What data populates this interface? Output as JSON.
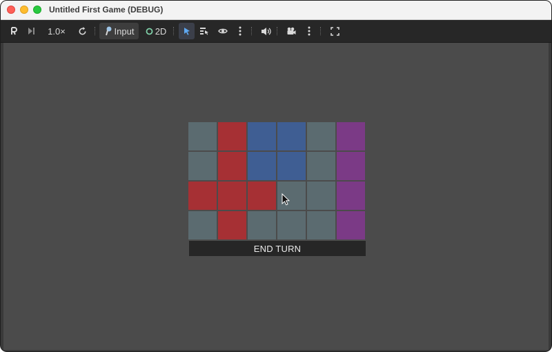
{
  "window": {
    "title": "Untitled First Game (DEBUG)"
  },
  "toolbar": {
    "speed_label": "1.0×",
    "input_label": "Input",
    "mode_2d_label": "2D"
  },
  "colors": {
    "gray": "#5b6b70",
    "red": "#a63034",
    "blue": "#3f5e93",
    "purple": "#7b3a86",
    "background": "#4b4b4b"
  },
  "board": {
    "rows": [
      [
        "gray",
        "red",
        "blue",
        "blue",
        "gray",
        "purple"
      ],
      [
        "gray",
        "red",
        "blue",
        "blue",
        "gray",
        "purple"
      ],
      [
        "red",
        "red",
        "red",
        "gray",
        "gray",
        "purple"
      ],
      [
        "gray",
        "red",
        "gray",
        "gray",
        "gray",
        "purple"
      ]
    ]
  },
  "end_turn_button": {
    "label": "END TURN"
  }
}
